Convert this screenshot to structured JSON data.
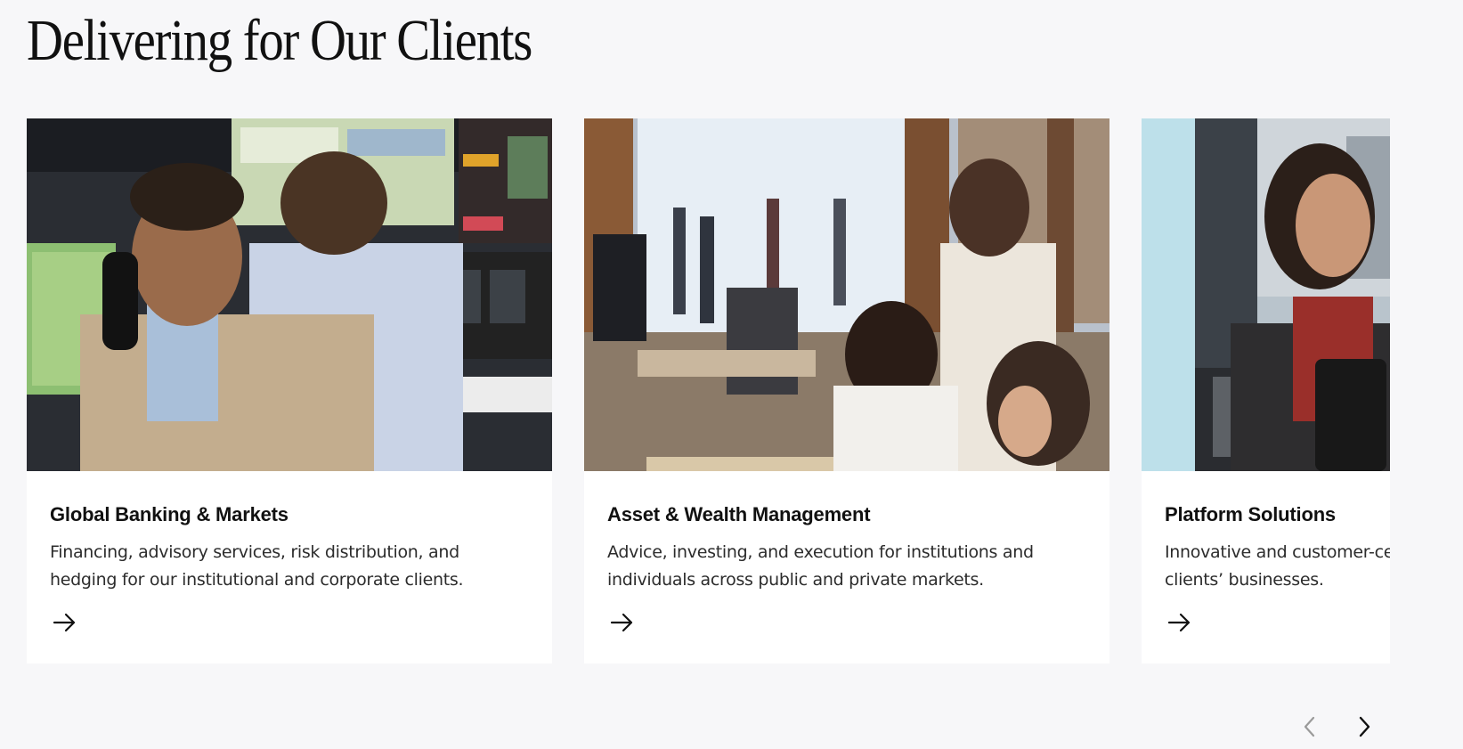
{
  "section": {
    "title": "Delivering for Our Clients"
  },
  "cards": [
    {
      "title": "Global Banking & Markets",
      "description": "Financing, advisory services, risk distribution, and hedging for our institutional and corporate clients.",
      "image_icon": "photo-trading-desk",
      "arrow_icon": "arrow-right-icon"
    },
    {
      "title": "Asset & Wealth Management",
      "description": "Advice, investing, and execution for institutions and individuals across public and private markets.",
      "image_icon": "photo-office-floor",
      "arrow_icon": "arrow-right-icon"
    },
    {
      "title": "Platform Solutions",
      "description": "Innovative and customer-centric platforms that power our clients’ businesses.",
      "image_icon": "photo-agent-headset",
      "arrow_icon": "arrow-right-icon"
    }
  ],
  "carousel": {
    "prev_icon": "chevron-left-icon",
    "next_icon": "chevron-right-icon",
    "prev_color": "#9a9a9a",
    "next_color": "#111111"
  },
  "colors": {
    "background": "#f7f7f9",
    "card": "#ffffff",
    "text": "#111111"
  }
}
